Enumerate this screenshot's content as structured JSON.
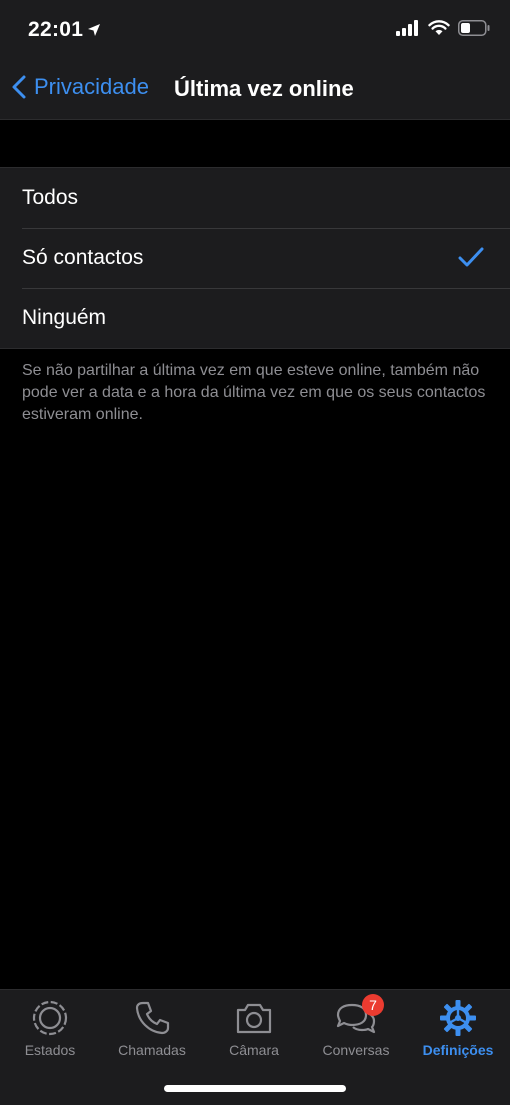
{
  "status_bar": {
    "time": "22:01",
    "icons": [
      "location-arrow-icon",
      "signal-icon",
      "wifi-icon",
      "battery-icon"
    ]
  },
  "nav": {
    "back_label": "Privacidade",
    "title": "Última vez online"
  },
  "options": [
    {
      "label": "Todos",
      "selected": false
    },
    {
      "label": "Só contactos",
      "selected": true
    },
    {
      "label": "Ninguém",
      "selected": false
    }
  ],
  "footnote": "Se não partilhar a última vez em que esteve online, também não pode ver a data e a hora da última vez em que os seus contactos estiveram online.",
  "tabs": [
    {
      "label": "Estados",
      "icon": "status-ring-icon",
      "active": false
    },
    {
      "label": "Chamadas",
      "icon": "phone-icon",
      "active": false
    },
    {
      "label": "Câmara",
      "icon": "camera-icon",
      "active": false
    },
    {
      "label": "Conversas",
      "icon": "chat-bubbles-icon",
      "active": false,
      "badge": "7"
    },
    {
      "label": "Definições",
      "icon": "settings-gear-icon",
      "active": true
    }
  ],
  "colors": {
    "accent": "#3d8ff0",
    "background": "#000000",
    "surface": "#1c1c1e",
    "secondary_text": "#8e8e93",
    "badge": "#eb3b30"
  }
}
